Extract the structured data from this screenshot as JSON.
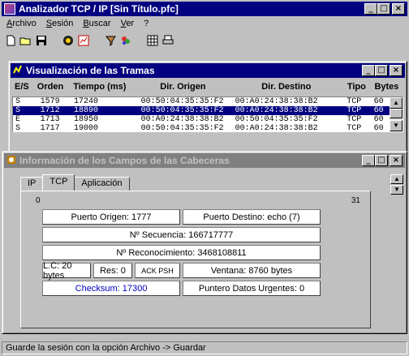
{
  "app": {
    "title": "Analizador TCP / IP  [Sin Título.pfc]"
  },
  "window_buttons": {
    "minimize": "_",
    "maximize": "□",
    "close": "×"
  },
  "menu": [
    "Archivo",
    "Sesión",
    "Buscar",
    "Ver",
    "?"
  ],
  "toolbar_icons": [
    "new-icon",
    "open-icon",
    "save-icon",
    "capture-icon",
    "chart-icon",
    "filter-icon",
    "colors-icon",
    "grid-icon",
    "print-icon"
  ],
  "frames": {
    "title": "Visualización de las Tramas",
    "headers": {
      "es": "E/S",
      "orden": "Orden",
      "tiempo": "Tiempo (ms)",
      "origen": "Dir. Origen",
      "destino": "Dir. Destino",
      "tipo": "Tipo",
      "bytes": "Bytes"
    },
    "rows": [
      {
        "es": "S",
        "orden": "1579",
        "tiempo": "17240",
        "origen": "00:50:04:35:35:F2",
        "destino": "00:A0:24:38:38:B2",
        "tipo": "TCP",
        "bytes": "60",
        "selected": false
      },
      {
        "es": "S",
        "orden": "1712",
        "tiempo": "18890",
        "origen": "00:50:04:35:35:F2",
        "destino": "00:A0:24:38:38:B2",
        "tipo": "TCP",
        "bytes": "60",
        "selected": true
      },
      {
        "es": "E",
        "orden": "1713",
        "tiempo": "18950",
        "origen": "00:A0:24:38:38:B2",
        "destino": "00:50:04:35:35:F2",
        "tipo": "TCP",
        "bytes": "60",
        "selected": false
      },
      {
        "es": "S",
        "orden": "1717",
        "tiempo": "19000",
        "origen": "00:50:04:35:35:F2",
        "destino": "00:A0:24:38:38:B2",
        "tipo": "TCP",
        "bytes": "60",
        "selected": false
      }
    ]
  },
  "info": {
    "title": "Información de los Campos de las Cabeceras",
    "tabs": [
      "IP",
      "TCP",
      "Aplicación"
    ],
    "active_tab": "TCP",
    "bit_start": "0",
    "bit_end": "31",
    "fields": {
      "puerto_origen": "Puerto Origen: 1777",
      "puerto_destino": "Puerto Destino: echo (7)",
      "secuencia": "Nº Secuencia: 166717777",
      "reconocimiento": "Nº Reconocimiento: 3468108811",
      "lc": "L.C: 20 bytes",
      "res": "Res: 0",
      "flags": "ACK PSH",
      "ventana": "Ventana: 8760 bytes",
      "checksum": "Checksum: 17300",
      "urgentes": "Puntero Datos Urgentes: 0"
    },
    "checksum_color": "#0000c0"
  },
  "status": "Guarde la sesión con la opción Archivo -> Guardar"
}
